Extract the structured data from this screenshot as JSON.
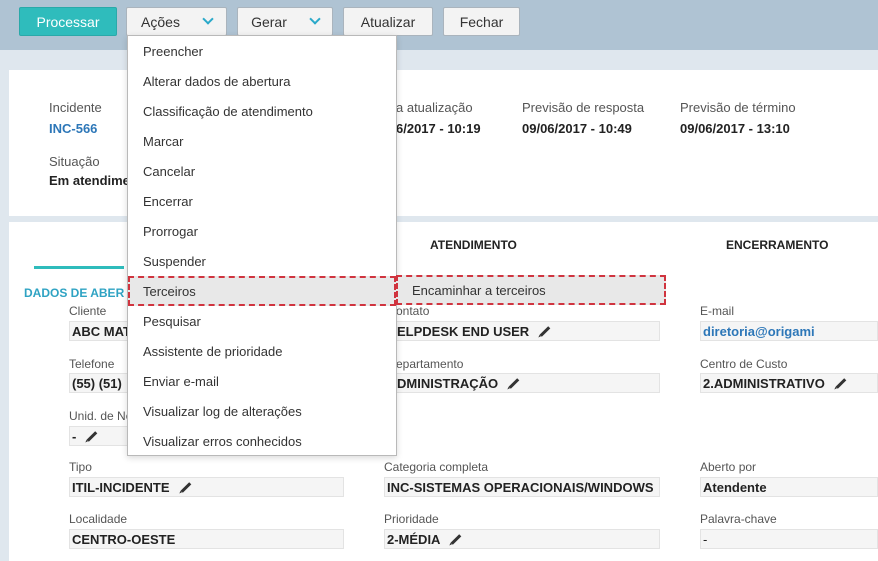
{
  "toolbar": {
    "processar": "Processar",
    "acoes": "Ações",
    "gerar": "Gerar",
    "atualizar": "Atualizar",
    "fechar": "Fechar"
  },
  "header": {
    "incidente_label": "Incidente",
    "incidente_value": "INC-566",
    "atualizacao_label": "a atualização",
    "atualizacao_value": "6/2017 - 10:19",
    "previsao_resposta_label": "Previsão de resposta",
    "previsao_resposta_value": "09/06/2017 - 10:49",
    "previsao_termino_label": "Previsão de término",
    "previsao_termino_value": "09/06/2017 - 13:10",
    "situacao_label": "Situação",
    "situacao_value": "Em atendime"
  },
  "tabs": {
    "atendimento": "ATENDIMENTO",
    "encerramento": "ENCERRAMENTO"
  },
  "section": {
    "title": "DADOS DE ABER"
  },
  "fields": {
    "cliente_label": "Cliente",
    "cliente_value": "ABC MAT",
    "contato_label": "ontato",
    "contato_value": "ELPDESK END USER",
    "email_label": "E-mail",
    "email_value": "diretoria@origami",
    "telefone_label": "Telefone",
    "telefone_value": "(55) (51)",
    "departamento_label": "epartamento",
    "departamento_value": "DMINISTRAÇÃO",
    "centro_custo_label": "Centro de Custo",
    "centro_custo_value": "2.ADMINISTRATIVO",
    "unid_label": "Unid. de Ne",
    "unid_value": "-",
    "tipo_label": "Tipo",
    "tipo_value": "ITIL-INCIDENTE",
    "categoria_label": "Categoria completa",
    "categoria_value": "INC-SISTEMAS OPERACIONAIS/WINDOWS",
    "aberto_por_label": "Aberto por",
    "aberto_por_value": "Atendente",
    "localidade_label": "Localidade",
    "localidade_value": "CENTRO-OESTE",
    "prioridade_label": "Prioridade",
    "prioridade_value": "2-MÉDIA",
    "palavra_chave_label": "Palavra-chave",
    "palavra_chave_value": "-"
  },
  "menu": {
    "items": [
      "Preencher",
      "Alterar dados de abertura",
      "Classificação de atendimento",
      "Marcar",
      "Cancelar",
      "Encerrar",
      "Prorrogar",
      "Suspender",
      "Terceiros",
      "Pesquisar",
      "Assistente de prioridade",
      "Enviar e-mail",
      "Visualizar log de alterações",
      "Visualizar erros conhecidos"
    ],
    "submenu_item": "Encaminhar a terceiros"
  },
  "colors": {
    "accent": "#2fbcbc",
    "highlight_border": "#d0343f",
    "link": "#2d77b8"
  }
}
